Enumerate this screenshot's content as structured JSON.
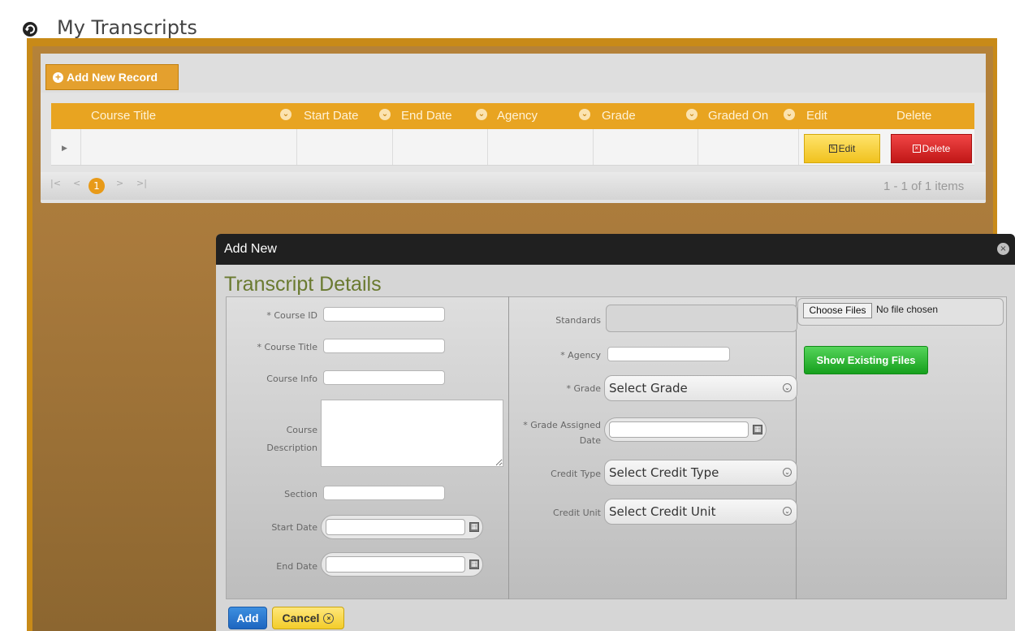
{
  "page": {
    "title": "My Transcripts"
  },
  "toolbar": {
    "add_record_label": "Add New Record"
  },
  "grid": {
    "columns": [
      "Course Title",
      "Start Date",
      "End Date",
      "Agency",
      "Grade",
      "Graded On",
      "Edit",
      "Delete"
    ],
    "row_actions": {
      "edit_label": "Edit",
      "delete_label": "Delete"
    },
    "pager": {
      "current_page": "1",
      "info": "1 - 1 of 1 items"
    }
  },
  "modal": {
    "title": "Add New",
    "section_title": "Transcript Details",
    "fields": {
      "course_id": "* Course ID",
      "course_title": "* Course Title",
      "course_info": "Course Info",
      "course_description": "Course Description",
      "section": "Section",
      "start_date": "Start Date",
      "end_date": "End Date",
      "standards": "Standards",
      "agency": "* Agency",
      "grade": "* Grade",
      "grade_assigned_date": "* Grade Assigned Date",
      "credit_type": "Credit Type",
      "credit_unit": "Credit Unit"
    },
    "selects": {
      "grade": "Select Grade",
      "credit_type": "Select Credit Type",
      "credit_unit": "Select Credit Unit"
    },
    "file": {
      "choose_label": "Choose Files",
      "status": "No file chosen",
      "show_existing_label": "Show Existing Files"
    },
    "buttons": {
      "add_label": "Add",
      "cancel_label": "Cancel"
    }
  },
  "colors": {
    "header_orange": "#e8a421",
    "edit_yellow": "#f0c21e",
    "delete_red": "#c11717",
    "show_files_green": "#16a01d",
    "add_blue": "#1e66c0"
  }
}
